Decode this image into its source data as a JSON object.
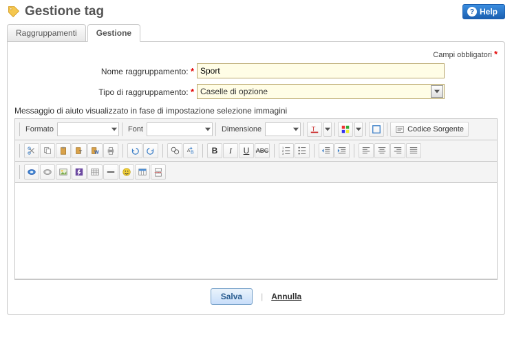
{
  "header": {
    "title": "Gestione tag",
    "help_label": "Help"
  },
  "tabs": {
    "grouping": "Raggruppamenti",
    "manage": "Gestione",
    "active_index": 1
  },
  "form": {
    "required_note": "Campi obbligatori",
    "name_label": "Nome raggruppamento:",
    "name_value": "Sport",
    "type_label": "Tipo di raggruppamento:",
    "type_value": "Caselle di opzione",
    "help_message_label": "Messaggio di aiuto visualizzato in fase di impostazione selezione immagini"
  },
  "editor": {
    "format_label": "Formato",
    "font_label": "Font",
    "size_label": "Dimensione",
    "source_label": "Codice Sorgente",
    "content": ""
  },
  "actions": {
    "save": "Salva",
    "cancel": "Annulla"
  }
}
